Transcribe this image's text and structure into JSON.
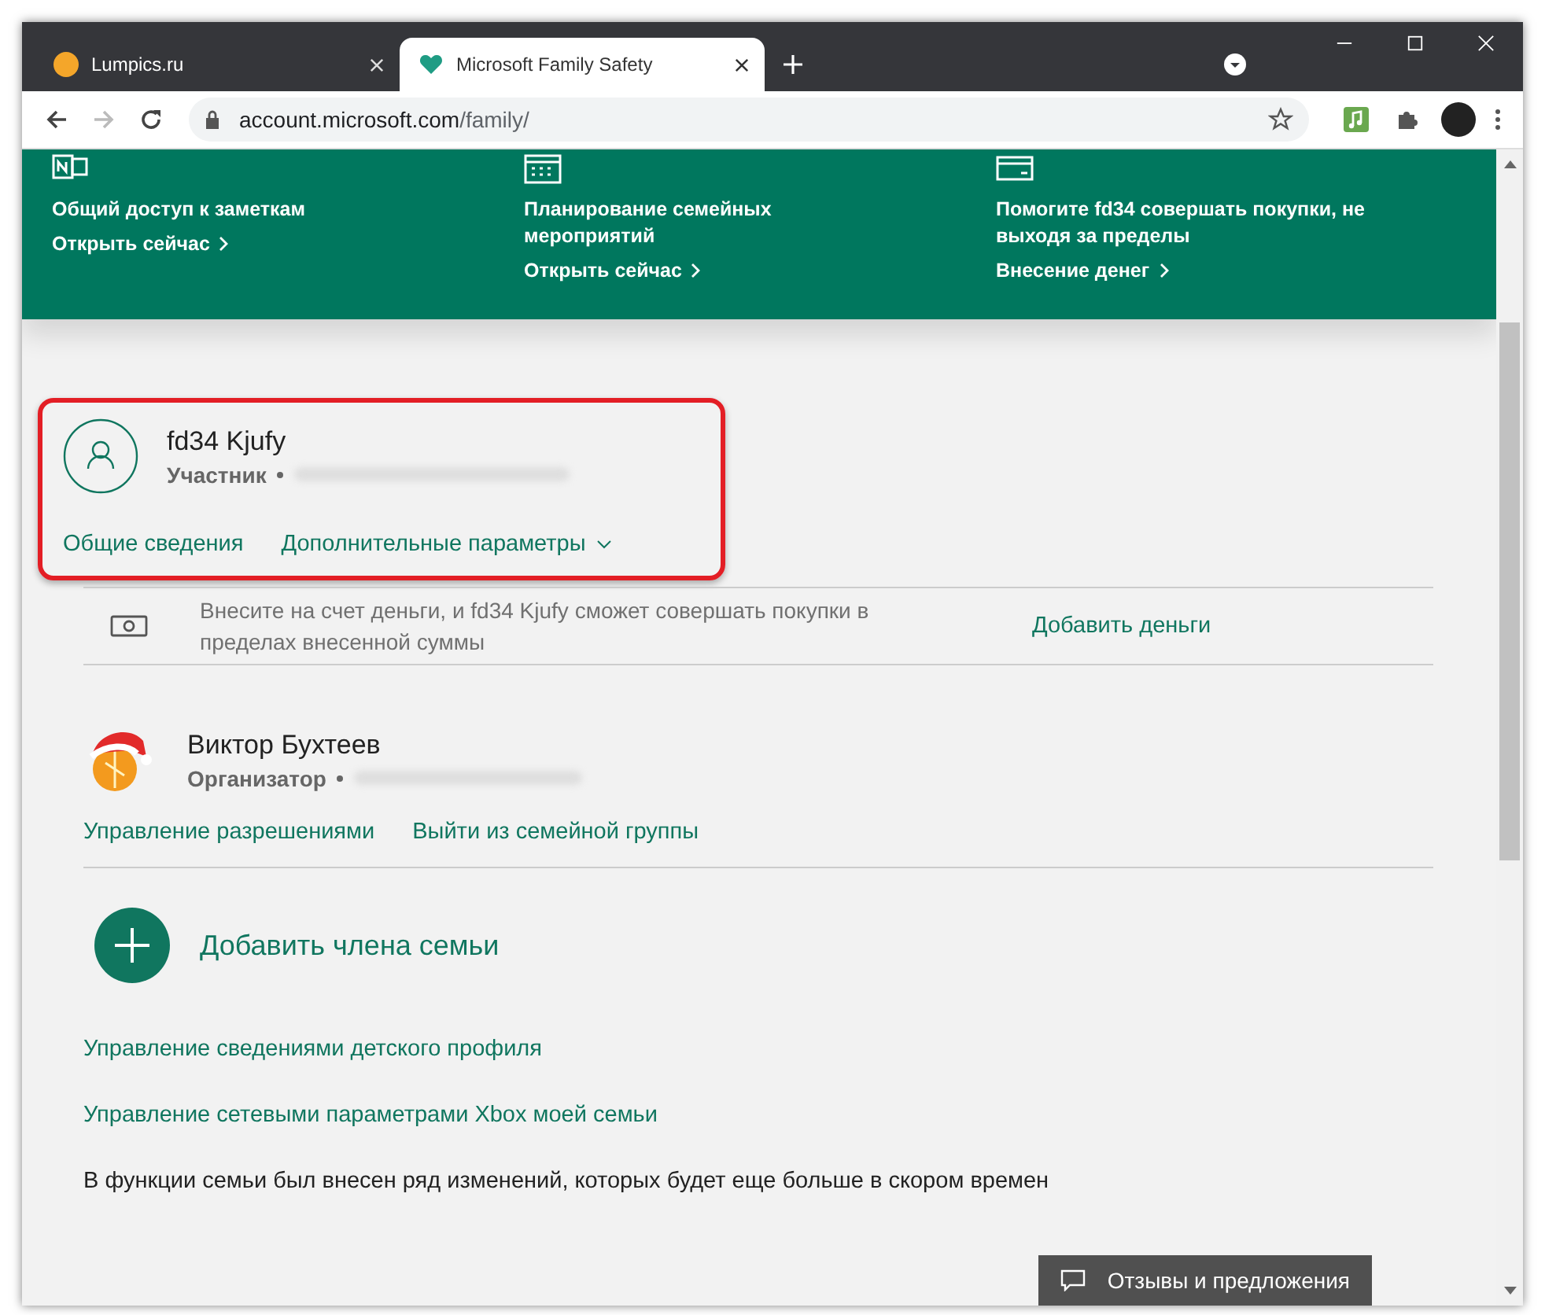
{
  "browser": {
    "tabs": [
      {
        "title": "Lumpics.ru",
        "kind": "dot",
        "selected": false
      },
      {
        "title": "Microsoft Family Safety",
        "kind": "heart",
        "selected": true
      }
    ],
    "address": {
      "host": "account.microsoft.com",
      "path": "/family/"
    }
  },
  "banner": {
    "items": [
      {
        "kind": "notes",
        "title": "Общий доступ к заметкам",
        "link": "Открыть сейчас"
      },
      {
        "kind": "calendar",
        "title": "Планирование семейных мероприятий",
        "link": "Открыть сейчас"
      },
      {
        "kind": "card",
        "title": "Помогите fd34 совершать покупки, не выходя за пределы",
        "link": "Внесение денег"
      }
    ]
  },
  "members": [
    {
      "kind": "outline",
      "name": "fd34 Kjufy",
      "role": "Участник",
      "highlighted": true,
      "links": [
        {
          "label": "Общие сведения",
          "caret": false
        },
        {
          "label": "Дополнительные параметры",
          "caret": true
        }
      ],
      "payment": {
        "text": "Внесите на счет деньги, и fd34 Kjufy сможет совершать покупки в пределах внесенной суммы",
        "link": "Добавить деньги"
      }
    },
    {
      "kind": "picture",
      "name": "Виктор Бухтеев",
      "role": "Организатор",
      "highlighted": false,
      "links": [
        {
          "label": "Управление разрешениями",
          "caret": false
        },
        {
          "label": "Выйти из семейной группы",
          "caret": false
        }
      ]
    }
  ],
  "add_member": "Добавить члена семьи",
  "links": [
    "Управление сведениями детского профиля",
    "Управление сетевыми параметрами Xbox моей семьи"
  ],
  "notice": "В функции семьи был внесен ряд изменений, которых будет еще больше в скором времен",
  "feedback_button": "Отзывы и предложения"
}
